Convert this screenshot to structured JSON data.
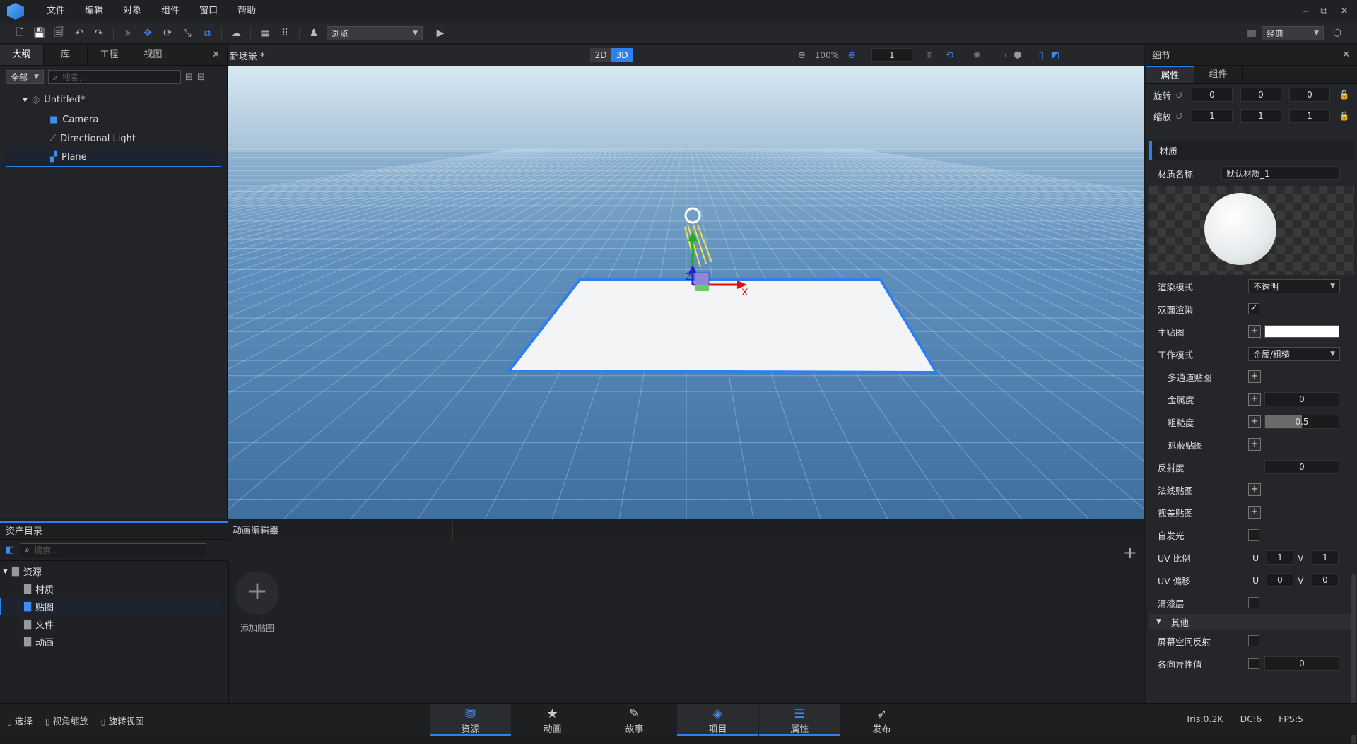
{
  "menu": [
    "文件",
    "编辑",
    "对象",
    "组件",
    "窗口",
    "帮助"
  ],
  "window_controls": [
    "–",
    "⧉",
    "✕"
  ],
  "toolbar": {
    "view_mode": "浏览",
    "layout": "经典"
  },
  "left_panel": {
    "tabs": [
      "大纲",
      "库",
      "工程",
      "视图"
    ],
    "filter": "全部",
    "search_placeholder": "搜索...",
    "tree": [
      {
        "label": "Untitled*",
        "icon": "scene-icon",
        "indent": 0
      },
      {
        "label": "Camera",
        "icon": "camera-icon",
        "indent": 1
      },
      {
        "label": "Directional Light",
        "icon": "light-icon",
        "indent": 1
      },
      {
        "label": "Plane",
        "icon": "mesh-icon",
        "indent": 1,
        "selected": true
      }
    ]
  },
  "viewport": {
    "tab": "新场景 *",
    "mode_2d": "2D",
    "mode_3d": "3D",
    "zoom": "100%",
    "grid_value": "1",
    "axis_x": "X",
    "axis_z": "Z"
  },
  "right_panel": {
    "title": "细节",
    "tabs": [
      "属性",
      "组件"
    ],
    "rotation_label": "旋转",
    "rotation": [
      "0",
      "0",
      "0"
    ],
    "scale_label": "缩放",
    "scale": [
      "1",
      "1",
      "1"
    ],
    "material_section": "材质",
    "material_name_label": "材质名称",
    "material_name": "默认材质_1",
    "render_mode_label": "渲染模式",
    "render_mode": "不透明",
    "double_sided_label": "双面渲染",
    "main_tex_label": "主贴图",
    "work_mode_label": "工作模式",
    "work_mode": "金属/粗糙",
    "multi_channel_label": "多通道贴图",
    "metallic_label": "金属度",
    "metallic": "0",
    "roughness_label": "粗糙度",
    "roughness": "0.5",
    "occlusion_label": "遮蔽贴图",
    "reflectance_label": "反射度",
    "reflectance": "0",
    "normal_label": "法线贴图",
    "parallax_label": "视差贴图",
    "emissive_label": "自发光",
    "uv_scale_label": "UV 比例",
    "uv_scale_u": "1",
    "uv_scale_v": "1",
    "uv_offset_label": "UV 偏移",
    "uv_offset_u": "0",
    "uv_offset_v": "0",
    "clearcoat_label": "清漆层",
    "other_section": "其他",
    "ssr_label": "屏幕空间反射",
    "aniso_label": "各向异性值",
    "aniso": "0",
    "u": "U",
    "v": "V"
  },
  "asset_panel": {
    "title": "资产目录",
    "search_placeholder": "搜索...",
    "tree": [
      {
        "label": "资源",
        "indent": 0
      },
      {
        "label": "材质",
        "indent": 1
      },
      {
        "label": "贴图",
        "indent": 1,
        "selected": true
      },
      {
        "label": "文件",
        "indent": 1
      },
      {
        "label": "动画",
        "indent": 1
      }
    ]
  },
  "anim_panel": {
    "title": "动画编辑器",
    "add_texture_label": "添加贴图"
  },
  "statusbar": {
    "hints": [
      "选择",
      "视角缩放",
      "旋转视图"
    ],
    "modes": [
      {
        "label": "资源",
        "icon": "assets-icon",
        "active": true
      },
      {
        "label": "动画",
        "icon": "animation-icon"
      },
      {
        "label": "故事",
        "icon": "story-icon"
      },
      {
        "label": "项目",
        "icon": "project-icon",
        "active": true
      },
      {
        "label": "属性",
        "icon": "properties-icon",
        "active": true
      },
      {
        "label": "发布",
        "icon": "publish-icon"
      }
    ],
    "tris": "Tris:0.2K",
    "dc": "DC:6",
    "fps": "FPS:5"
  },
  "colors": {
    "accent": "#2f80ed",
    "panel_bg": "#232427",
    "sky_top": "#c9dbe8",
    "floor": "#4c7fb0"
  }
}
